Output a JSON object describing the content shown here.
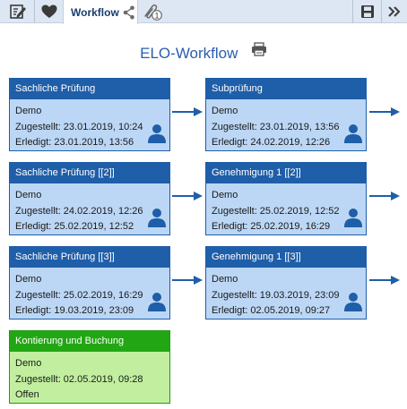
{
  "toolbar": {
    "active_tab": "Workflow",
    "attachment_count": "1",
    "icons": [
      "edit-icon",
      "heart-icon",
      "share-icon",
      "attachment-icon",
      "save-icon",
      "double-chevron-right-icon"
    ]
  },
  "title": "ELO-Workflow",
  "colors": {
    "active": "#1f5ea8",
    "active_bg": "#bcd7f5",
    "done": "#23a614",
    "done_bg": "#c2ef9f",
    "title": "#2a5db0"
  },
  "nodes": [
    {
      "title": "Sachliche Prüfung",
      "user": "Demo",
      "line2": "Zugestellt: 23.01.2019, 10:24",
      "line3": "Erledigt: 23.01.2019, 13:56",
      "status": "active"
    },
    {
      "title": "Subprüfung",
      "user": "Demo",
      "line2": "Zugestellt: 23.01.2019, 13:56",
      "line3": "Erledigt: 24.02.2019, 12:26",
      "status": "active"
    },
    {
      "title": "Sachliche Prüfung [[2]]",
      "user": "Demo",
      "line2": "Zugestellt: 24.02.2019, 12:26",
      "line3": "Erledigt: 25.02.2019, 12:52",
      "status": "active"
    },
    {
      "title": "Genehmigung 1 [[2]]",
      "user": "Demo",
      "line2": "Zugestellt: 25.02.2019, 12:52",
      "line3": "Erledigt: 25.02.2019, 16:29",
      "status": "active"
    },
    {
      "title": "Sachliche Prüfung [[3]]",
      "user": "Demo",
      "line2": "Zugestellt: 25.02.2019, 16:29",
      "line3": "Erledigt: 19.03.2019, 23:09",
      "status": "active"
    },
    {
      "title": "Genehmigung 1 [[3]]",
      "user": "Demo",
      "line2": "Zugestellt: 19.03.2019, 23:09",
      "line3": "Erledigt: 02.05.2019, 09:27",
      "status": "active"
    },
    {
      "title": "Kontierung und Buchung",
      "user": "Demo",
      "line2": "Zugestellt: 02.05.2019, 09:28",
      "line3": "Offen",
      "status": "done"
    }
  ]
}
